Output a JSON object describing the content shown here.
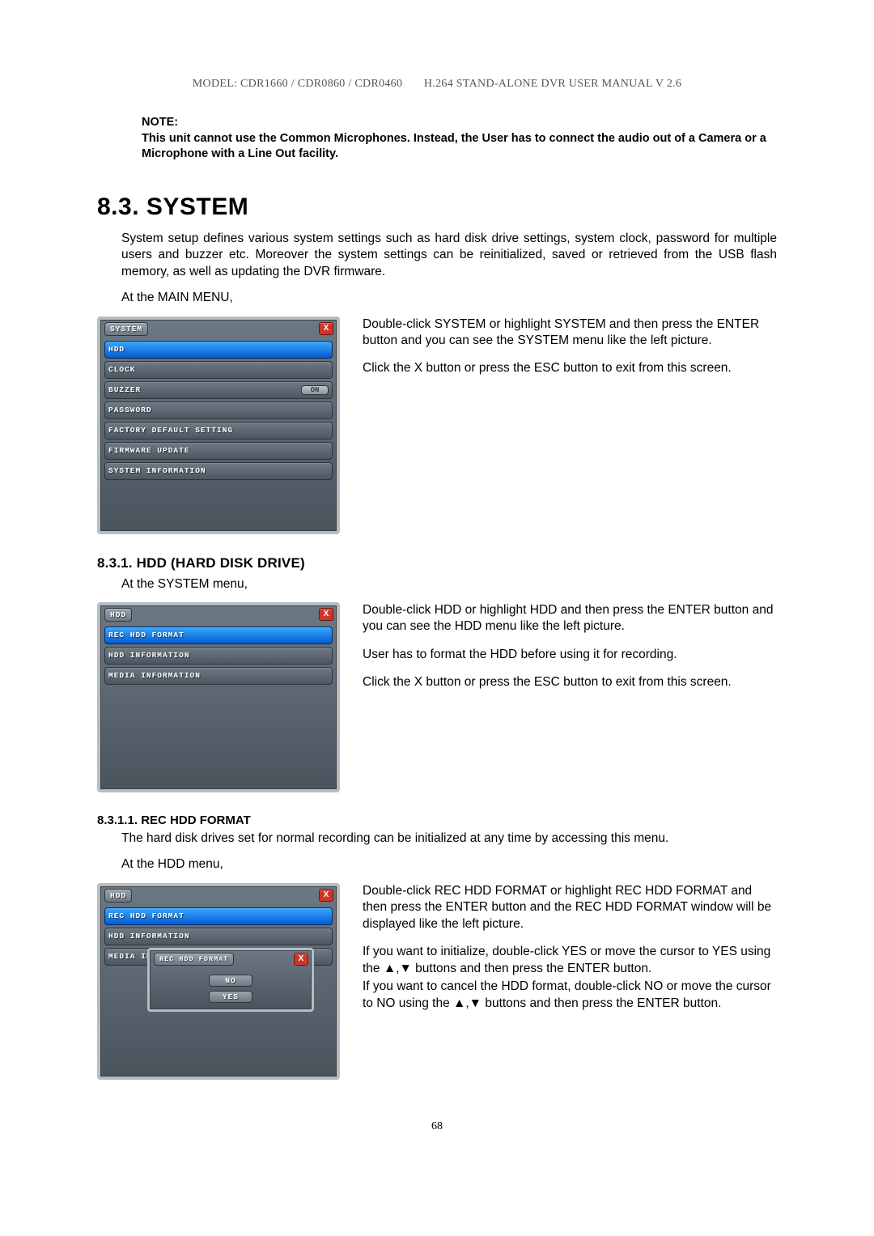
{
  "header": {
    "left": "MODEL: CDR1660 / CDR0860 / CDR0460",
    "right": "H.264 STAND-ALONE DVR USER MANUAL V 2.6"
  },
  "note": {
    "title": "NOTE:",
    "body": "This unit cannot use the Common Microphones.   Instead, the User has to connect the audio out of a Camera or a Microphone with a Line Out facility."
  },
  "section": {
    "num_title": "8.3. SYSTEM",
    "intro": "System setup defines various system settings such as hard disk drive settings, system clock, password for multiple users and buzzer etc.   Moreover the system settings can be reinitialized, saved or retrieved from the USB flash memory, as well as updating the DVR firmware.",
    "at_main": "At the MAIN MENU,"
  },
  "system_panel": {
    "title": "SYSTEM",
    "items": [
      {
        "label": "HDD",
        "selected": true
      },
      {
        "label": "CLOCK"
      },
      {
        "label": "BUZZER",
        "value": "ON"
      },
      {
        "label": "PASSWORD"
      },
      {
        "label": "FACTORY DEFAULT SETTING"
      },
      {
        "label": "FIRMWARE UPDATE"
      },
      {
        "label": "SYSTEM INFORMATION"
      }
    ],
    "side_p1": "Double-click SYSTEM or highlight SYSTEM and then press the ENTER button and you can see the SYSTEM menu like the left picture.",
    "side_p2": "Click the X button or press the ESC button to exit from this screen."
  },
  "hdd_section": {
    "title": "8.3.1.  HDD (HARD DISK DRIVE)",
    "at_system": "At the SYSTEM menu,"
  },
  "hdd_panel": {
    "title": "HDD",
    "items": [
      {
        "label": "REC HDD FORMAT",
        "selected": true
      },
      {
        "label": "HDD INFORMATION"
      },
      {
        "label": "MEDIA INFORMATION"
      }
    ],
    "side_p1": "Double-click HDD or highlight HDD and then press the ENTER button and you can see the HDD menu like the left picture.",
    "side_p2": "User has to format the HDD before using it for recording.",
    "side_p3": "Click the X button or press the ESC button to exit from this screen."
  },
  "rec_section": {
    "title": "8.3.1.1. REC HDD FORMAT",
    "desc": "The hard disk drives set for normal recording can be initialized at any time by accessing this menu.",
    "at_hdd": "At the HDD menu,"
  },
  "rec_panel": {
    "title": "HDD",
    "items": [
      {
        "label": "REC HDD FORMAT",
        "selected": true
      },
      {
        "label": "HDD INFORMATION"
      },
      {
        "label": "MEDIA INFORMATION"
      }
    ],
    "popup": {
      "title": "REC HDD FORMAT",
      "no": "NO",
      "yes": "YES"
    },
    "side_p1": "Double-click REC HDD FORMAT or highlight REC HDD FORMAT and then press the ENTER button and the REC HDD FORMAT window will be displayed like the left picture.",
    "side_p2a": "If you want to initialize, double-click YES or move the cursor to YES using the ",
    "side_p2b": " buttons and then press the ENTER button.",
    "side_p3a": "If you want to cancel the HDD format, double-click NO or move the cursor to NO using the ",
    "side_p3b": " buttons and then press the ENTER button."
  },
  "arrows": "▲,▼",
  "close_x": "X",
  "page_number": "68"
}
